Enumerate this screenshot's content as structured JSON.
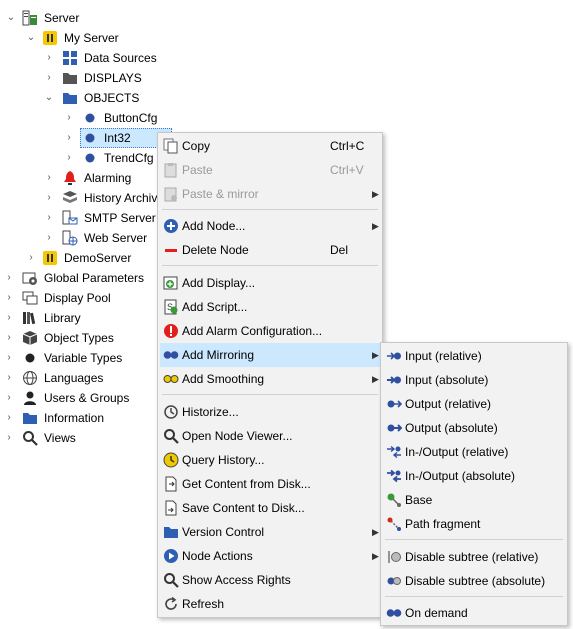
{
  "tree": {
    "server": "Server",
    "my_server": "My Server",
    "data_sources": "Data Sources",
    "displays": "DISPLAYS",
    "objects": "OBJECTS",
    "button_cfg": "ButtonCfg",
    "int32": "Int32",
    "trend_cfg": "TrendCfg",
    "alarming": "Alarming",
    "history_archive": "History Archiv",
    "smtp_server": "SMTP Server",
    "web_server": "Web Server",
    "demo_server": "DemoServer",
    "global_parameters": "Global Parameters",
    "display_pool": "Display Pool",
    "library": "Library",
    "object_types": "Object Types",
    "variable_types": "Variable Types",
    "languages": "Languages",
    "users_groups": "Users & Groups",
    "information": "Information",
    "views": "Views"
  },
  "context_menu": {
    "copy": "Copy",
    "copy_shortcut": "Ctrl+C",
    "paste": "Paste",
    "paste_shortcut": "Ctrl+V",
    "paste_mirror": "Paste & mirror",
    "add_node": "Add Node...",
    "delete_node": "Delete Node",
    "delete_shortcut": "Del",
    "add_display": "Add Display...",
    "add_script": "Add Script...",
    "add_alarm": "Add Alarm Configuration...",
    "add_mirroring": "Add Mirroring",
    "add_smoothing": "Add Smoothing",
    "historize": "Historize...",
    "open_node_viewer": "Open Node Viewer...",
    "query_history": "Query History...",
    "get_content": "Get Content from Disk...",
    "save_content": "Save Content to Disk...",
    "version_control": "Version Control",
    "node_actions": "Node Actions",
    "show_access_rights": "Show Access Rights",
    "refresh": "Refresh"
  },
  "submenu": {
    "input_relative": "Input (relative)",
    "input_absolute": "Input (absolute)",
    "output_relative": "Output (relative)",
    "output_absolute": "Output (absolute)",
    "inout_relative": "In-/Output (relative)",
    "inout_absolute": "In-/Output (absolute)",
    "base": "Base",
    "path_fragment": "Path fragment",
    "disable_subtree_relative": "Disable subtree (relative)",
    "disable_subtree_absolute": "Disable subtree (absolute)",
    "on_demand": "On demand"
  },
  "colors": {
    "highlight": "#cce8ff",
    "accent_blue": "#2f5fb3",
    "alarm_red": "#e0201b",
    "menu_bg": "#f2f2f2"
  }
}
